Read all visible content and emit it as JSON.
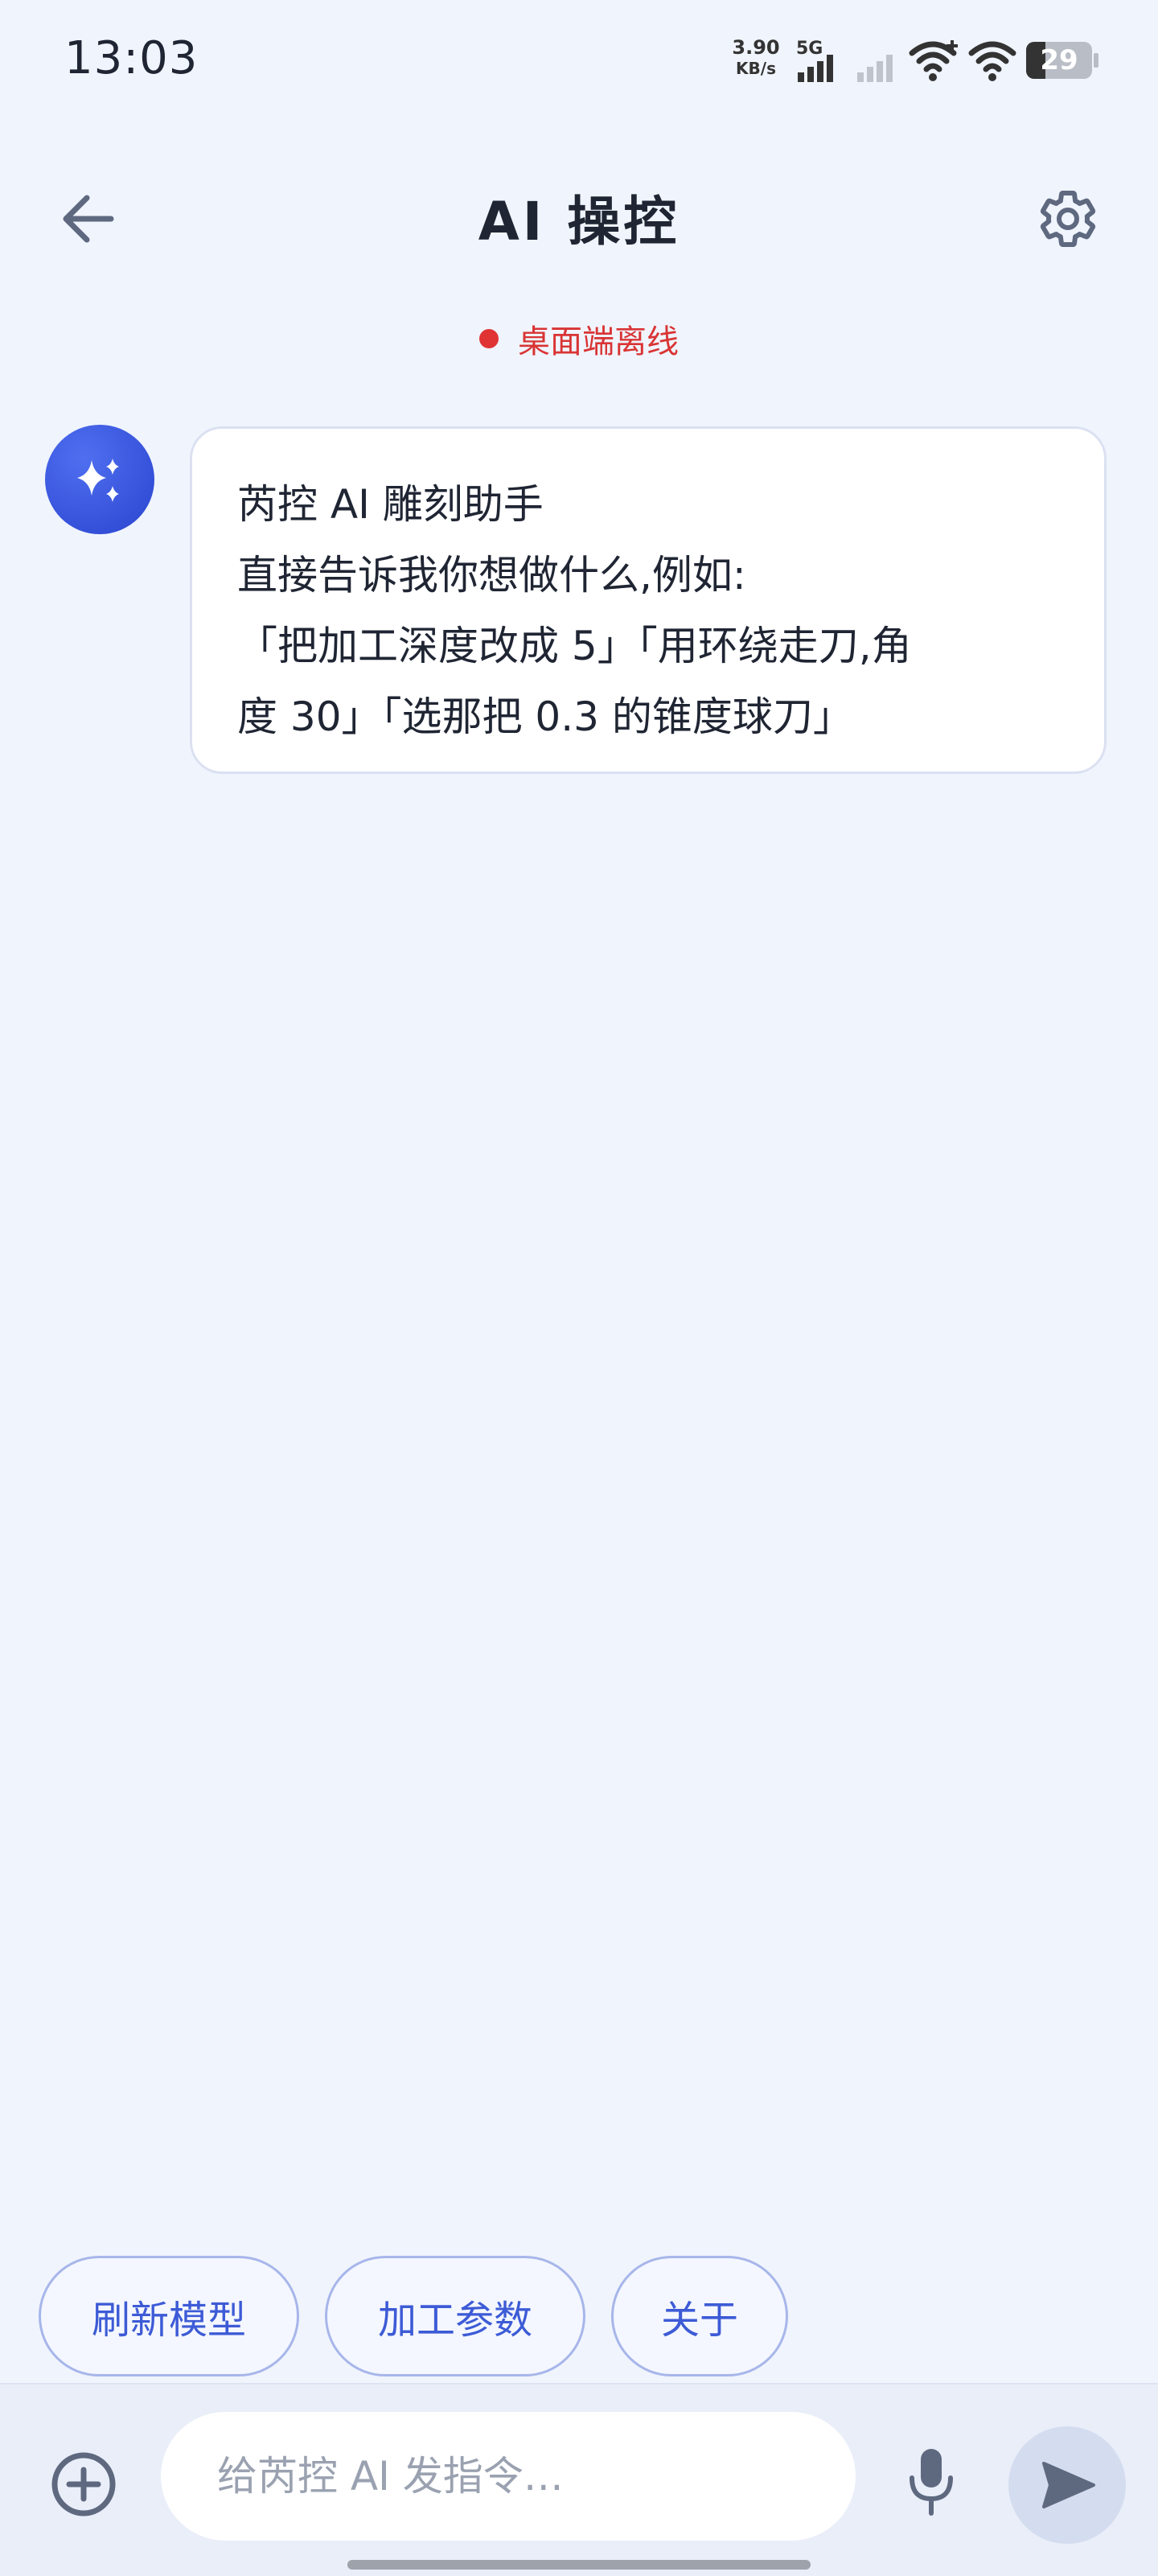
{
  "status_bar": {
    "time": "13:03",
    "net_speed_value": "3.90",
    "net_speed_unit": "KB/s",
    "network_type": "5G",
    "battery": "29"
  },
  "header": {
    "title": "AI 操控",
    "back_icon": "arrow-left-icon",
    "settings_icon": "gear-icon"
  },
  "connection": {
    "status_text": "桌面端离线",
    "status_color": "#e03434"
  },
  "assistant_message": {
    "avatar_icon": "sparkle-icon",
    "lines": [
      "芮控 AI 雕刻助手",
      "直接告诉我你想做什么,例如:",
      "「把加工深度改成 5」「用环绕走刀,角",
      "度 30」「选那把 0.3 的锥度球刀」"
    ]
  },
  "quick_actions": [
    "刷新模型",
    "加工参数",
    "关于"
  ],
  "composer": {
    "placeholder": "给芮控 AI 发指令…",
    "value": "",
    "add_icon": "plus-circle-icon",
    "mic_icon": "microphone-icon",
    "send_icon": "send-icon"
  },
  "colors": {
    "accent": "#3d5bd6",
    "background": "#f0f4fd"
  }
}
